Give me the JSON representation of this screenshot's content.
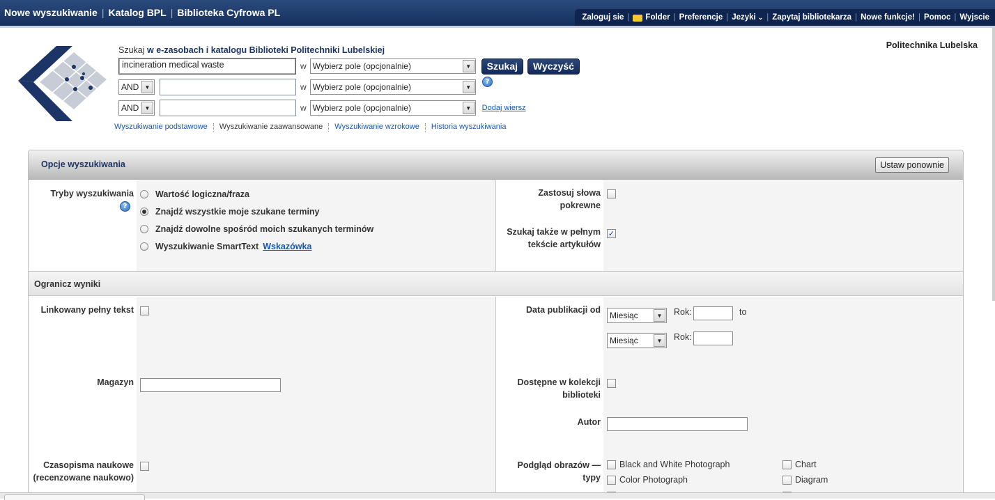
{
  "topnav": {
    "items": [
      "Nowe wyszukiwanie",
      "Katalog BPL",
      "Biblioteka Cyfrowa PL"
    ]
  },
  "toolbar": {
    "login": "Zaloguj sie",
    "folder": "Folder",
    "preferences": "Preferencje",
    "languages": "Jezyki",
    "ask_librarian": "Zapytaj bibliotekarza",
    "new_features": "Nowe funkcje!",
    "help": "Pomoc",
    "exit": "Wyjscie"
  },
  "institution": "Politechnika Lubelska",
  "search": {
    "label_prefix": "Szukaj",
    "label_scope": "w e-zasobach i katalogu Biblioteki Politechniki Lubelskiej",
    "in_word": "w",
    "row1_value": "incineration medical waste",
    "field_placeholder": "Wybierz pole (opcjonalnie)",
    "bool_op": "AND",
    "search_button": "Szukaj",
    "clear_button": "Wyczyść",
    "add_row": "Dodaj wiersz"
  },
  "search_modes": {
    "basic": "Wyszukiwanie podstawowe",
    "advanced": "Wyszukiwanie zaawansowane",
    "visual": "Wyszukiwanie wzrokowe",
    "history": "Historia wyszukiwania"
  },
  "options": {
    "title": "Opcje wyszukiwania",
    "reset_button": "Ustaw ponownie",
    "modes_label": "Tryby wyszukiwania",
    "modes": [
      "Wartość logiczna/fraza",
      "Znajdź wszystkie moje szukane terminy",
      "Znajdź dowolne spośród moich szukanych terminów",
      "Wyszukiwanie SmartText"
    ],
    "selected_mode": 1,
    "smarttext_hint": "Wskazówka",
    "related_words_label": "Zastosuj słowa pokrewne",
    "fulltext_label": "Szukaj także w pełnym tekście artykułów",
    "fulltext_checked": true
  },
  "limit": {
    "title": "Ogranicz wyniki",
    "linked_fulltext": "Linkowany pełny tekst",
    "pub_date_label": "Data publikacji od",
    "month_select": "Miesiąc",
    "year_label": "Rok:",
    "to_word": "to",
    "magazine_label": "Magazyn",
    "available_label": "Dostępne w kolekcji biblioteki",
    "author_label": "Autor",
    "peer_reviewed_label": "Czasopisma naukowe (recenzowane naukowo)",
    "image_preview_label": "Podgląd obrazów — typy",
    "image_types_col1": [
      "Black and White Photograph",
      "Color Photograph"
    ],
    "image_types_col2": [
      "Chart",
      "Diagram"
    ]
  }
}
